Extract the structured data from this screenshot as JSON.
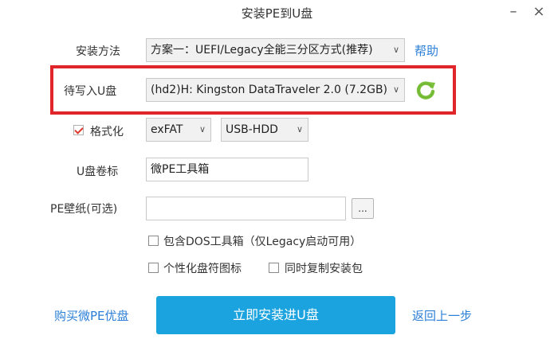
{
  "window": {
    "title": "安装PE到U盘",
    "minimize_glyph": "–",
    "close_glyph": "×"
  },
  "install_method": {
    "label": "安装方法",
    "selected": "方案一：UEFI/Legacy全能三分区方式(推荐)",
    "help_link": "帮助"
  },
  "target_drive": {
    "label": "待写入U盘",
    "selected": "(hd2)H: Kingston DataTraveler 2.0 (7.2GB)",
    "refresh_icon": "refresh-icon",
    "highlight_color": "#e0252b"
  },
  "format": {
    "label": "格式化",
    "checked": true,
    "filesystem": "exFAT",
    "mode": "USB-HDD"
  },
  "volume_label": {
    "label": "U盘卷标",
    "value": "微PE工具箱"
  },
  "wallpaper": {
    "label": "PE壁纸(可选)",
    "value": "",
    "browse_label": "..."
  },
  "options": {
    "include_dos": "包含DOS工具箱（仅Legacy启动可用）",
    "custom_icon": "个性化盘符图标",
    "copy_installer": "同时复制安装包"
  },
  "footer": {
    "buy_link": "购买微PE优盘",
    "install_button": "立即安装进U盘",
    "back_link": "返回上一步",
    "accent_color": "#1aa3de"
  }
}
